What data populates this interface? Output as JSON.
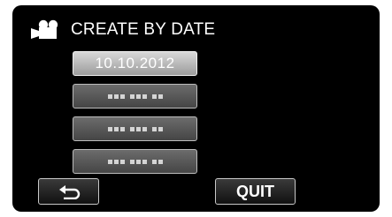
{
  "header": {
    "icon": "video-camera-icon",
    "title": "CREATE BY DATE"
  },
  "date_list": {
    "items": [
      {
        "label": "10.10.2012",
        "selected": true
      },
      {
        "label": "",
        "selected": false
      },
      {
        "label": "",
        "selected": false
      },
      {
        "label": "",
        "selected": false
      }
    ]
  },
  "footer": {
    "back_icon": "return-arrow-icon",
    "quit_label": "QUIT"
  },
  "colors": {
    "screen_background": "#000000",
    "text": "#ffffff",
    "selected_item": "#b0b0b0"
  }
}
